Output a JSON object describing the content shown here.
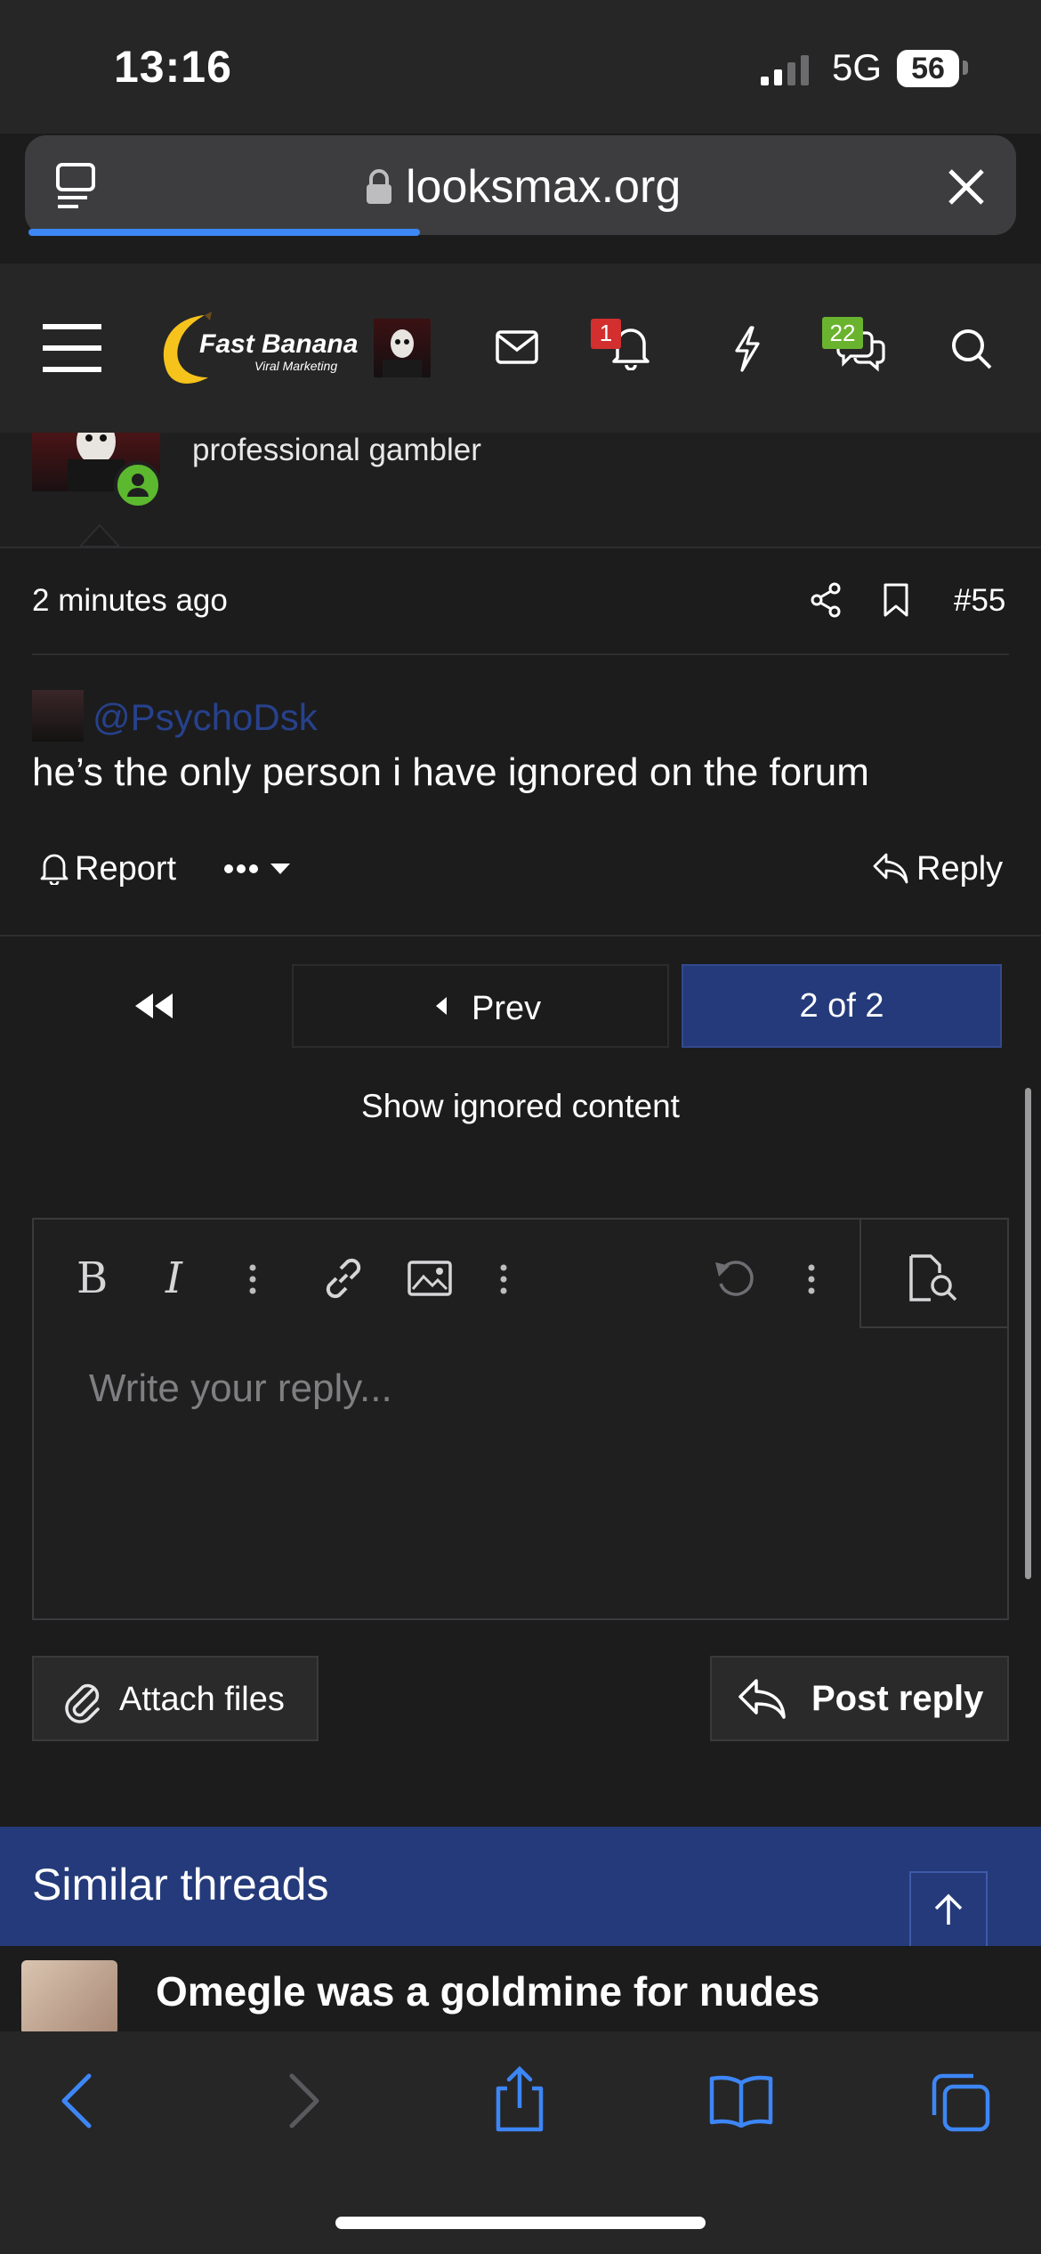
{
  "status_bar": {
    "time": "13:16",
    "network": "5G",
    "battery": "56"
  },
  "browser": {
    "url": "looksmax.org",
    "progress_percent": 38
  },
  "site_header": {
    "logo_text": "Fast Banana",
    "logo_subtext": "Viral Marketing",
    "notifications_count": "1",
    "conversations_count": "22"
  },
  "post": {
    "user_title": "professional gambler",
    "time": "2 minutes ago",
    "post_number": "#55",
    "mention": "@PsychoDsk",
    "body": "he’s the only person i have ignored on the forum",
    "actions": {
      "report": "Report",
      "reply": "Reply"
    }
  },
  "pagination": {
    "prev_label": "Prev",
    "current": "2 of 2"
  },
  "show_ignored": "Show ignored content",
  "editor": {
    "placeholder": "Write your reply...",
    "attach_label": "Attach files",
    "post_reply_label": "Post reply"
  },
  "similar_threads": {
    "heading": "Similar threads",
    "items": [
      {
        "title": "Omegle was a goldmine for nudes"
      }
    ]
  },
  "colors": {
    "accent": "#243a7a",
    "mention": "#27418b",
    "online": "#5cb82f",
    "alert": "#d32f2f"
  }
}
